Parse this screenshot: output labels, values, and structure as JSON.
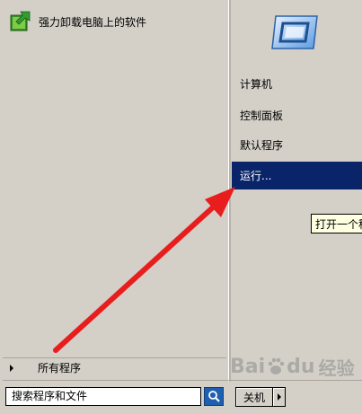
{
  "left_pane": {
    "pinned_program": {
      "label": "强力卸载电脑上的软件",
      "icon": "uninstall-app-icon"
    },
    "all_programs_label": "所有程序"
  },
  "search": {
    "placeholder": "搜索程序和文件",
    "icon": "search-icon"
  },
  "right_pane": {
    "user_picture_icon": "user-picture-icon",
    "items": [
      {
        "label": "计算机"
      },
      {
        "label": "控制面板"
      },
      {
        "label": "默认程序"
      },
      {
        "label": "运行..."
      }
    ],
    "selected_index": 3,
    "selected_color": "#0a246a"
  },
  "tooltip": {
    "text": "打开一个程序"
  },
  "shutdown": {
    "label": "关机",
    "arrow_icon": "chevron-right-icon"
  },
  "overlay": {
    "arrow_color": "#e81d1d"
  },
  "watermark": {
    "brand": "Baidu",
    "suffix": "经验"
  }
}
